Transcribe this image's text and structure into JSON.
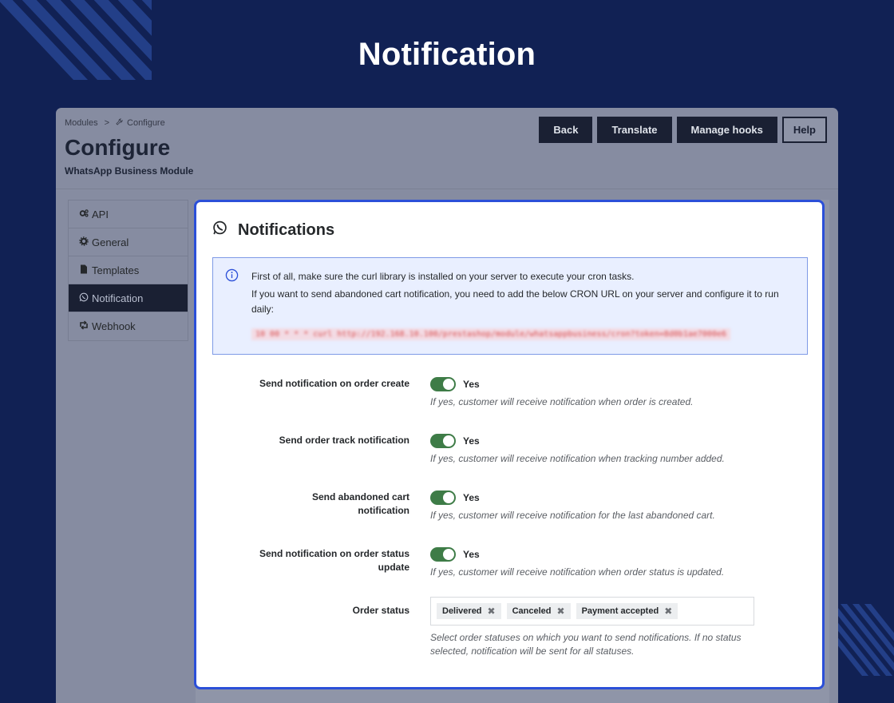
{
  "hero": {
    "title": "Notification"
  },
  "breadcrumb": {
    "root": "Modules",
    "separator": ">",
    "current": "Configure"
  },
  "page": {
    "title": "Configure",
    "subtitle": "WhatsApp Business Module"
  },
  "toolbar": {
    "back": "Back",
    "translate": "Translate",
    "manage_hooks": "Manage hooks",
    "help": "Help"
  },
  "tabs": [
    {
      "label": "API",
      "icon": "cogs-icon"
    },
    {
      "label": "General",
      "icon": "cog-icon"
    },
    {
      "label": "Templates",
      "icon": "file-icon"
    },
    {
      "label": "Notification",
      "icon": "whatsapp-icon",
      "active": true
    },
    {
      "label": "Webhook",
      "icon": "retweet-icon"
    }
  ],
  "panel": {
    "title": "Notifications",
    "alert": {
      "line1": "First of all, make sure the curl library is installed on your server to execute your cron tasks.",
      "line2": "If you want to send abandoned cart notification, you need to add the below CRON URL on your server and configure it to run daily:",
      "cron": "10 00 * * * curl http://192.168.10.100/prestashop/module/whatsappbusiness/cron?token=8d0b1ae7000e6"
    },
    "fields": [
      {
        "label": "Send notification on order create",
        "value": "Yes",
        "help": "If yes, customer will receive notification when order is created."
      },
      {
        "label": "Send order track notification",
        "value": "Yes",
        "help": "If yes, customer will receive notification when tracking number added."
      },
      {
        "label": "Send abandoned cart notification",
        "value": "Yes",
        "help": "If yes, customer will receive notification for the last abandoned cart."
      },
      {
        "label": "Send notification on order status update",
        "value": "Yes",
        "help": "If yes, customer will receive notification when order status is updated."
      }
    ],
    "order_status": {
      "label": "Order status",
      "chips": [
        "Delivered",
        "Canceled",
        "Payment accepted"
      ],
      "help": "Select order statuses on which you want to send notifications. If no status selected, notification will be sent for all statuses."
    }
  },
  "colors": {
    "background": "#112154",
    "accent": "#2b4fd8",
    "toggle_on": "#3e7c47",
    "dark_button": "#1a2033"
  }
}
